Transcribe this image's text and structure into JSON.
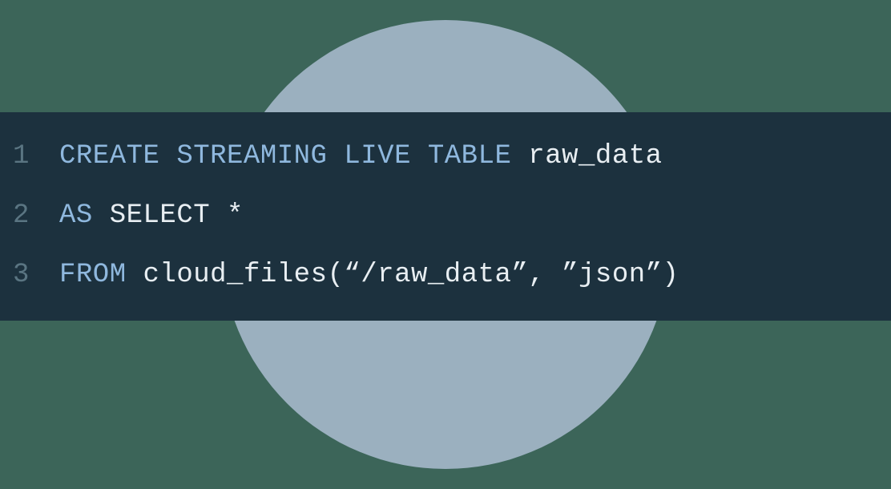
{
  "code": {
    "lines": [
      {
        "number": "1",
        "tokens": [
          {
            "type": "keyword",
            "text": "CREATE STREAMING LIVE TABLE"
          },
          {
            "type": "plain",
            "text": " "
          },
          {
            "type": "identifier",
            "text": "raw_data"
          }
        ]
      },
      {
        "number": "2",
        "tokens": [
          {
            "type": "keyword",
            "text": "AS"
          },
          {
            "type": "plain",
            "text": " "
          },
          {
            "type": "identifier",
            "text": "SELECT *"
          }
        ]
      },
      {
        "number": "3",
        "tokens": [
          {
            "type": "keyword",
            "text": "FROM"
          },
          {
            "type": "plain",
            "text": " "
          },
          {
            "type": "identifier",
            "text": "cloud_files(“/raw_data”, ”json”)"
          }
        ]
      }
    ]
  },
  "colors": {
    "background": "#3c6559",
    "circle": "#9bb0bf",
    "codeBackground": "#1c313e",
    "lineNumber": "#5a7582",
    "keyword": "#8fb8de",
    "identifier": "#e8eef2"
  }
}
